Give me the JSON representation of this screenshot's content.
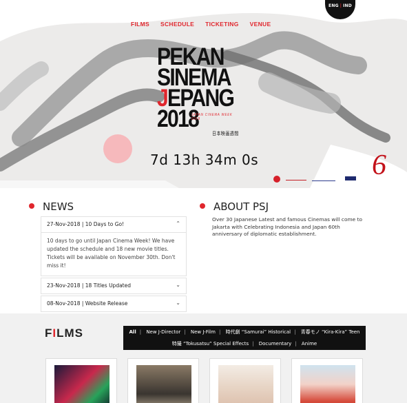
{
  "language": {
    "en": "ENG",
    "id": "IND"
  },
  "nav": [
    "FILMS",
    "SCHEDULE",
    "TICKETING",
    "VENUE"
  ],
  "logo": {
    "line1": "PEKAN",
    "line2": "SINEMA",
    "line3_j": "J",
    "line3_rest": "EPANG",
    "line4": "2018",
    "subtitle": "JAPAN CINEMA WEEK 2018",
    "kanji": "日本映画週間"
  },
  "countdown": "7d 13h 34m 0s",
  "news": {
    "title": "NEWS",
    "items": [
      {
        "header": "27-Nov-2018 | 10 Days to Go!",
        "body": "10 days to go until Japan Cinema Week! We have updated the schedule and 18 new movie titles. Tickets will be available on November 30th. Don't miss it!",
        "expanded": true
      },
      {
        "header": "23-Nov-2018 | 18 Titles Updated",
        "expanded": false
      },
      {
        "header": "08-Nov-2018 | Website Release",
        "expanded": false
      }
    ]
  },
  "about": {
    "title": "ABOUT PSJ",
    "text": "Over 30 Japanese Latest and famous Cinemas will come to Jakarta with Celebrating Indonesia and Japan 60th anniversary of diplomatic establishment."
  },
  "films": {
    "title_pre": "F",
    "title_red": "I",
    "title_post": "LMS",
    "filters_row1": [
      "All",
      "New J-Director",
      "New J-Film",
      "時代劇 “Samurai” Historical",
      "青春モノ “Kira-Kira” Teen"
    ],
    "filters_row2": [
      "特撮 “Tokusatsu” Special Effects",
      "Documentary",
      "Anime"
    ]
  },
  "colors": {
    "accent": "#e0262d",
    "dark": "#111111",
    "grey_bg": "#f1f1f1"
  }
}
